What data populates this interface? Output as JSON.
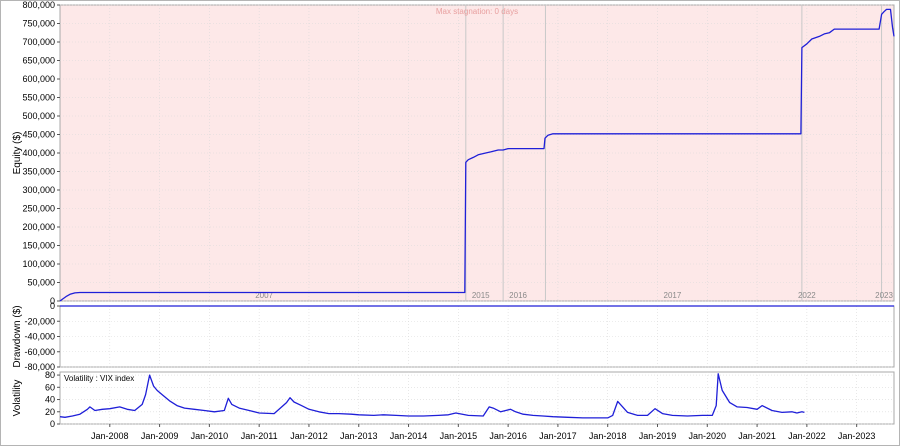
{
  "colors": {
    "series": "#1f1fd8",
    "stagnation_fill": "#fde8e8",
    "grid": "#d9d9d9",
    "period_line": "#c8c8c8"
  },
  "chart_data": [
    {
      "type": "line",
      "panel": "equity",
      "ylabel": "Equity ($)",
      "ylim": [
        0,
        800000
      ],
      "yticks": [
        0,
        50000,
        100000,
        150000,
        200000,
        250000,
        300000,
        350000,
        400000,
        450000,
        500000,
        550000,
        600000,
        650000,
        700000,
        750000,
        800000
      ],
      "ytick_labels": [
        "0",
        "50,000",
        "100,000",
        "150,000",
        "200,000",
        "250,000",
        "300,000",
        "350,000",
        "400,000",
        "450,000",
        "500,000",
        "550,000",
        "600,000",
        "650,000",
        "700,000",
        "750,000",
        "800,000"
      ],
      "xlim": [
        2007.0,
        2023.75
      ],
      "stagnation_label": "Max stagnation: 0 days",
      "background_shading": "light-red",
      "period_labels": [
        {
          "text": "2007",
          "x": 2011.1
        },
        {
          "text": "2015",
          "x": 2015.45
        },
        {
          "text": "2016",
          "x": 2016.2
        },
        {
          "text": "2017",
          "x": 2019.3
        },
        {
          "text": "2022",
          "x": 2022.0
        },
        {
          "text": "2023",
          "x": 2023.55
        }
      ],
      "period_dividers": [
        2015.15,
        2015.9,
        2016.75,
        2021.9,
        2023.5
      ],
      "series": [
        {
          "x": [
            2007.0,
            2007.05,
            2007.12,
            2007.2,
            2007.3,
            2007.4,
            2015.13,
            2015.15,
            2015.2,
            2015.3,
            2015.4,
            2015.55,
            2015.65,
            2015.8,
            2015.9,
            2016.0,
            2016.5,
            2016.72,
            2016.74,
            2016.8,
            2016.9,
            2017.0,
            2018.0,
            2019.0,
            2020.0,
            2021.0,
            2021.5,
            2021.88,
            2021.9,
            2022.0,
            2022.1,
            2022.25,
            2022.35,
            2022.45,
            2022.55,
            2022.65,
            2023.0,
            2023.2,
            2023.45,
            2023.5,
            2023.55,
            2023.6,
            2023.68,
            2023.72,
            2023.75
          ],
          "y": [
            0,
            5000,
            12000,
            18000,
            22000,
            23000,
            23000,
            375000,
            382000,
            388000,
            395000,
            400000,
            403000,
            408000,
            408000,
            412000,
            412000,
            412000,
            440000,
            448000,
            452000,
            452000,
            452000,
            452000,
            452000,
            452000,
            452000,
            452000,
            685000,
            695000,
            708000,
            715000,
            722000,
            725000,
            735000,
            735000,
            735000,
            735000,
            735000,
            775000,
            782000,
            788000,
            788000,
            740000,
            715000
          ]
        }
      ]
    },
    {
      "type": "line",
      "panel": "drawdown",
      "ylabel": "Drawdown ($)",
      "ylim": [
        -80000,
        0
      ],
      "yticks": [
        0,
        -20000,
        -40000,
        -60000,
        -80000
      ],
      "ytick_labels": [
        "0",
        "-20,000",
        "-40,000",
        "-60,000",
        "-80,000"
      ],
      "xlim": [
        2007.0,
        2023.75
      ],
      "series": [
        {
          "x": [
            2007.0,
            2023.75
          ],
          "y": [
            0,
            0
          ]
        }
      ]
    },
    {
      "type": "line",
      "panel": "volatility",
      "ylabel": "Volatility",
      "series_label": "Volatility : VIX index",
      "ylim": [
        0,
        85
      ],
      "yticks": [
        0,
        20,
        40,
        60,
        80
      ],
      "ytick_labels": [
        "0",
        "20",
        "40",
        "60",
        "80"
      ],
      "xlim": [
        2007.0,
        2023.75
      ],
      "xticks": [
        2008.0,
        2009.0,
        2010.0,
        2011.0,
        2012.0,
        2013.0,
        2014.0,
        2015.0,
        2016.0,
        2017.0,
        2018.0,
        2019.0,
        2020.0,
        2021.0,
        2022.0,
        2023.0
      ],
      "xtick_labels": [
        "Jan-2008",
        "Jan-2009",
        "Jan-2010",
        "Jan-2011",
        "Jan-2012",
        "Jan-2013",
        "Jan-2014",
        "Jan-2015",
        "Jan-2016",
        "Jan-2017",
        "Jan-2018",
        "Jan-2019",
        "Jan-2020",
        "Jan-2021",
        "Jan-2022",
        "Jan-2023"
      ],
      "series": [
        {
          "x": [
            2007.0,
            2007.1,
            2007.25,
            2007.4,
            2007.55,
            2007.6,
            2007.7,
            2007.85,
            2008.0,
            2008.2,
            2008.35,
            2008.5,
            2008.65,
            2008.72,
            2008.8,
            2008.88,
            2008.95,
            2009.05,
            2009.2,
            2009.35,
            2009.5,
            2009.7,
            2009.9,
            2010.1,
            2010.3,
            2010.38,
            2010.45,
            2010.6,
            2010.8,
            2011.0,
            2011.3,
            2011.55,
            2011.62,
            2011.7,
            2011.85,
            2012.0,
            2012.2,
            2012.4,
            2012.6,
            2012.85,
            2013.0,
            2013.3,
            2013.5,
            2013.75,
            2014.0,
            2014.3,
            2014.6,
            2014.8,
            2014.95,
            2015.2,
            2015.5,
            2015.62,
            2015.7,
            2015.85,
            2016.05,
            2016.15,
            2016.3,
            2016.5,
            2016.7,
            2016.9,
            2017.2,
            2017.5,
            2017.8,
            2018.0,
            2018.1,
            2018.2,
            2018.4,
            2018.6,
            2018.8,
            2018.95,
            2019.1,
            2019.3,
            2019.6,
            2019.9,
            2020.1,
            2020.18,
            2020.22,
            2020.3,
            2020.45,
            2020.6,
            2020.8,
            2021.0,
            2021.1,
            2021.3,
            2021.5,
            2021.7,
            2021.8,
            2021.9,
            2021.95
          ],
          "y": [
            12,
            11,
            13,
            16,
            24,
            28,
            22,
            24,
            25,
            28,
            24,
            22,
            32,
            48,
            80,
            62,
            55,
            48,
            38,
            30,
            26,
            24,
            22,
            20,
            22,
            42,
            32,
            26,
            22,
            18,
            17,
            35,
            43,
            36,
            30,
            24,
            20,
            17,
            17,
            16,
            15,
            14,
            15,
            14,
            13,
            13,
            14,
            15,
            18,
            14,
            13,
            28,
            26,
            20,
            24,
            20,
            16,
            14,
            13,
            12,
            11,
            10,
            10,
            10,
            14,
            37,
            19,
            14,
            14,
            25,
            17,
            14,
            13,
            14,
            14,
            30,
            82,
            55,
            35,
            28,
            27,
            24,
            30,
            22,
            19,
            20,
            18,
            20,
            19
          ]
        }
      ]
    }
  ]
}
